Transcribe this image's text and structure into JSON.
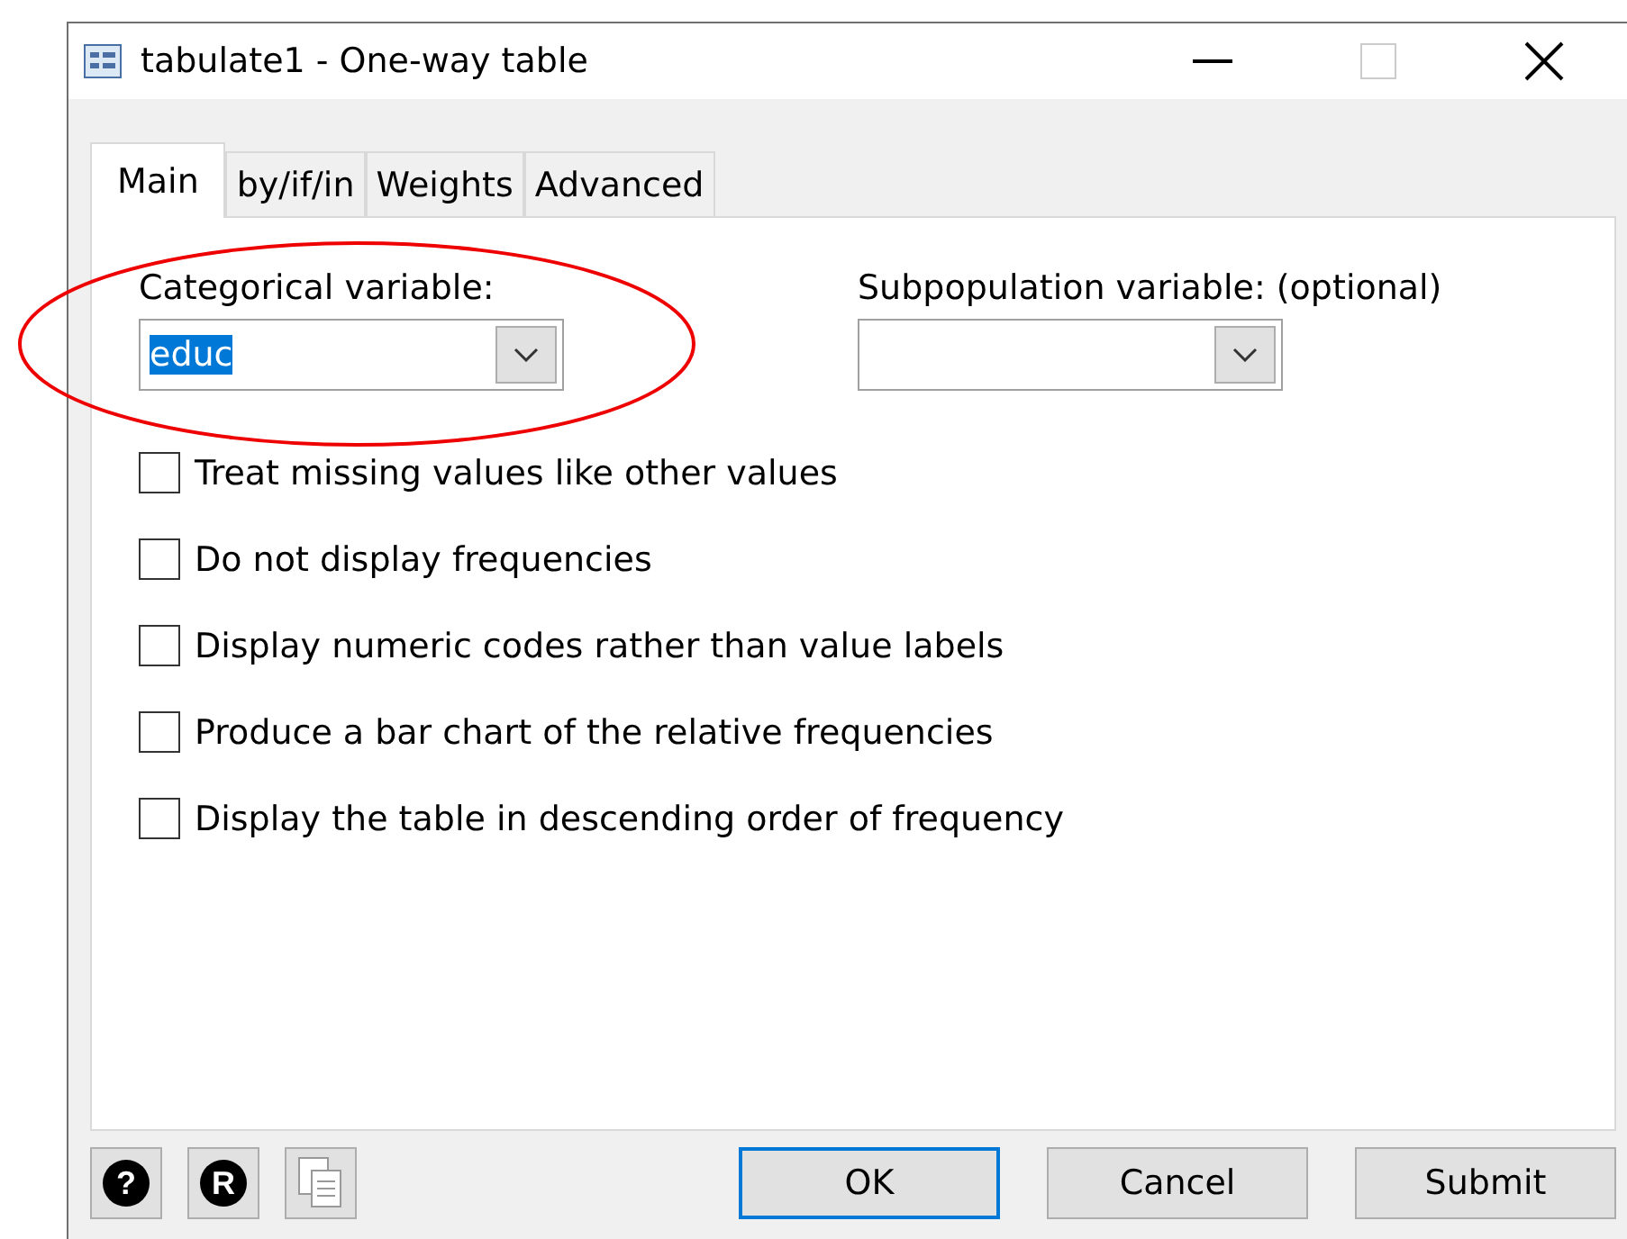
{
  "window": {
    "title": "tabulate1 - One-way table"
  },
  "tabs": [
    {
      "label": "Main",
      "selected": true
    },
    {
      "label": "by/if/in",
      "selected": false
    },
    {
      "label": "Weights",
      "selected": false
    },
    {
      "label": "Advanced",
      "selected": false
    }
  ],
  "fields": [
    {
      "label": "Categorical variable:",
      "value": "educ",
      "selected": true
    },
    {
      "label": "Subpopulation variable: (optional)"
    }
  ],
  "options": [
    {
      "label": "Treat missing values like other values",
      "checked": false
    },
    {
      "label": "Do not display frequencies",
      "checked": false
    },
    {
      "label": "Display numeric codes rather than value labels",
      "checked": false
    },
    {
      "label": "Produce a bar chart of the relative frequencies",
      "checked": false
    },
    {
      "label": "Display the table in descending order of frequency",
      "checked": false
    }
  ],
  "tool_buttons": [
    {
      "kind": "glyph",
      "glyph": "?"
    },
    {
      "kind": "glyph",
      "glyph": "R"
    },
    {
      "kind": "copy"
    }
  ],
  "buttons": [
    {
      "label": "OK",
      "selected": true
    },
    {
      "label": "Cancel",
      "selected": false
    },
    {
      "label": "Submit",
      "selected": false
    }
  ]
}
